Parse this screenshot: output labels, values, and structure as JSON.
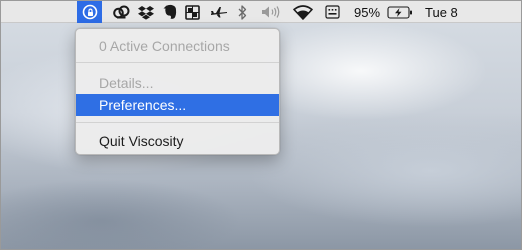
{
  "menubar": {
    "battery_percent": "95%",
    "clock": "Tue 8",
    "icons": [
      "viscosity-icon",
      "creative-cloud-icon",
      "dropbox-icon",
      "evernote-icon",
      "window-manager-icon",
      "airplane-icon",
      "bluetooth-icon",
      "volume-icon",
      "wifi-icon",
      "keyboard-input-icon",
      "battery-charging-icon"
    ]
  },
  "menu": {
    "active_connections": "0 Active Connections",
    "details": "Details...",
    "preferences": "Preferences...",
    "quit": "Quit Viscosity"
  },
  "colors": {
    "highlight": "#2f6fe4",
    "menubar_active": "#2d6ce6"
  }
}
